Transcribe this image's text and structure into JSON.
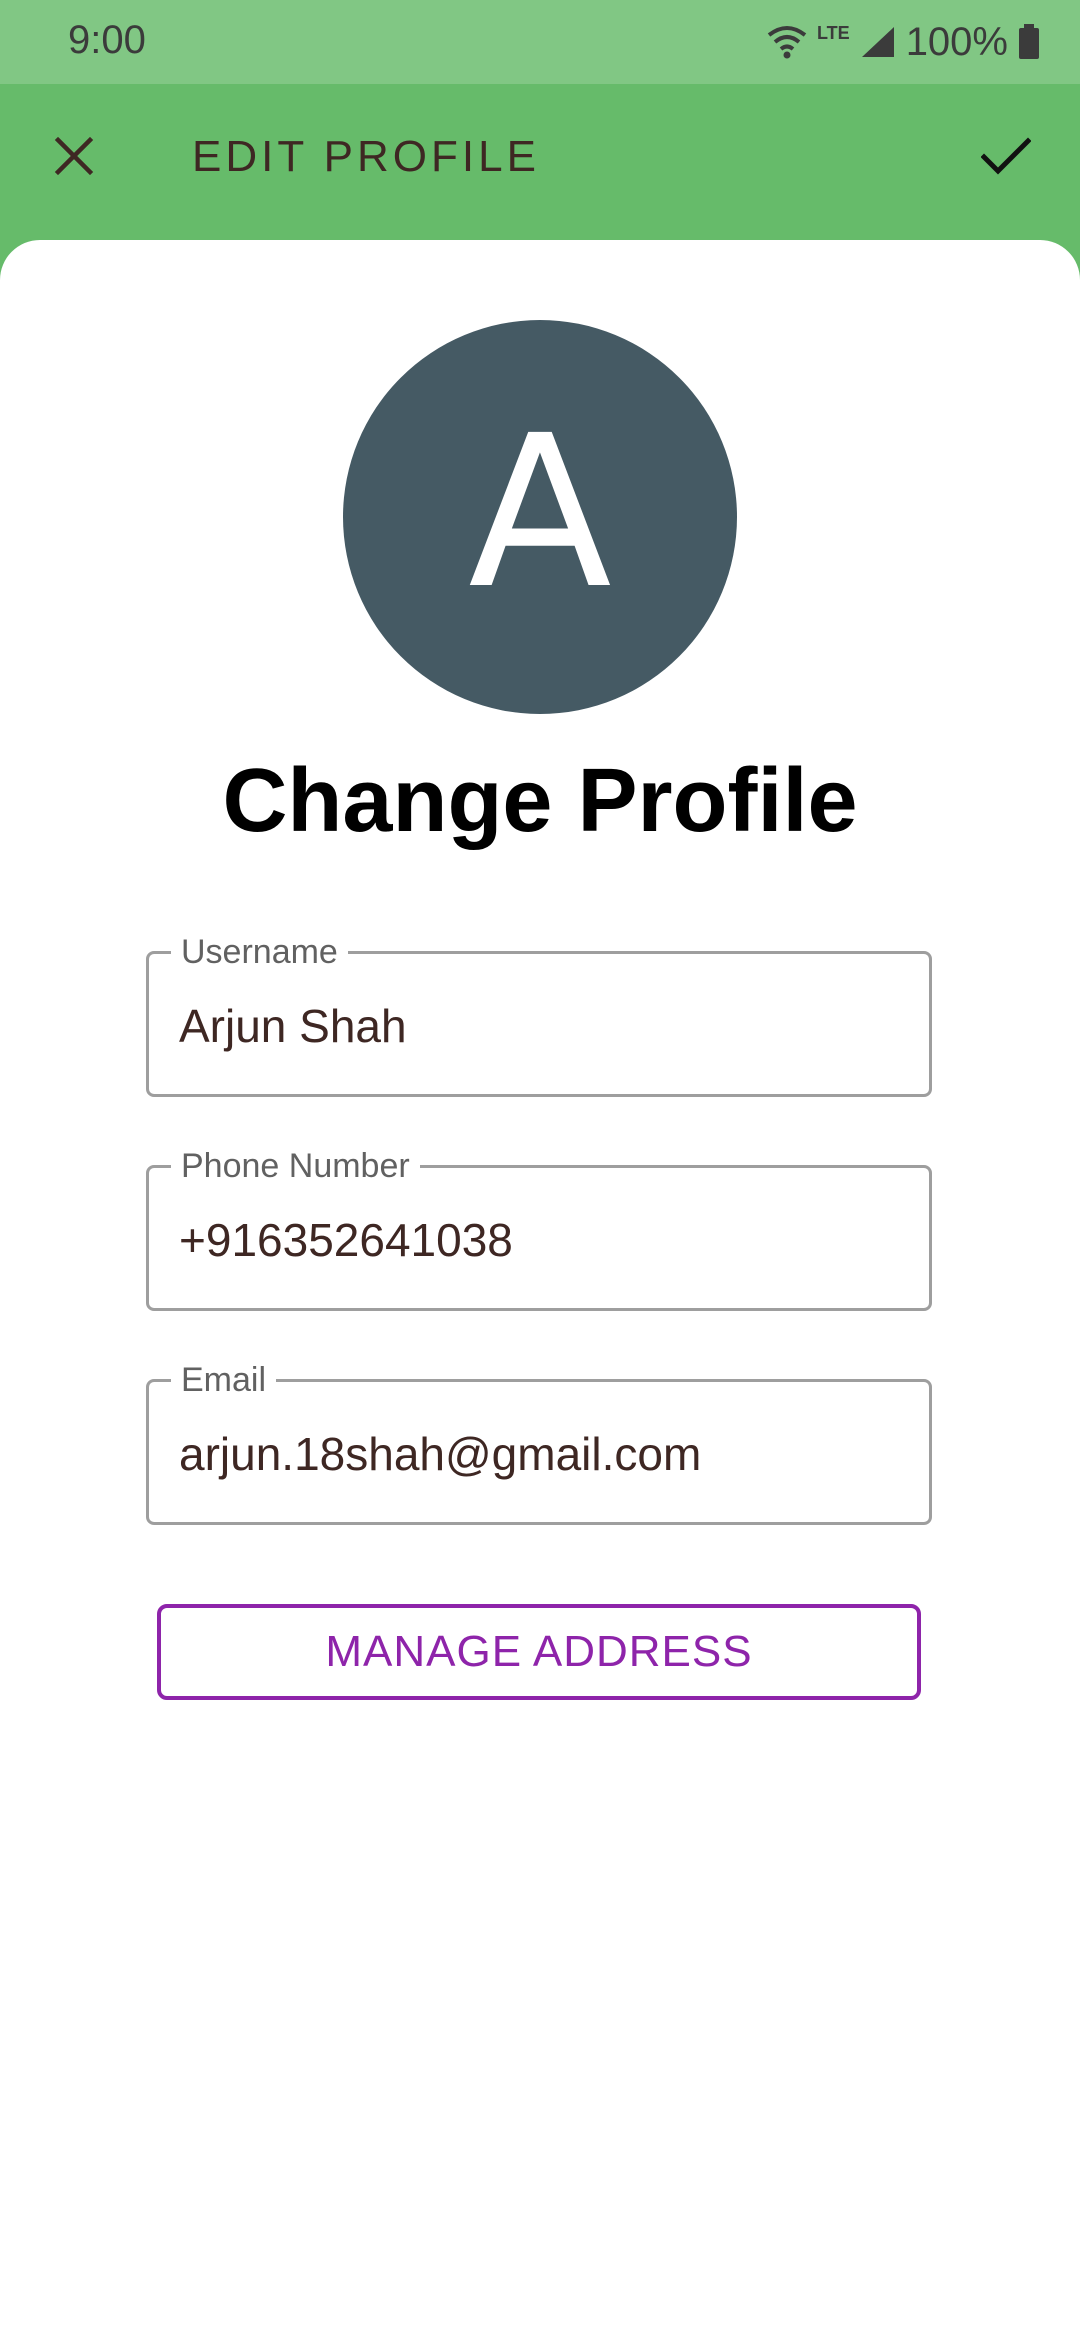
{
  "status_bar": {
    "time": "9:00",
    "network_type": "LTE",
    "battery": "100%"
  },
  "app_bar": {
    "title": "EDIT PROFILE",
    "close_icon": "close-icon",
    "confirm_icon": "check-icon"
  },
  "profile": {
    "avatar_letter": "A",
    "heading": "Change Profile"
  },
  "form": {
    "username": {
      "label": "Username",
      "value": "Arjun Shah"
    },
    "phone": {
      "label": "Phone Number",
      "value": "+916352641038"
    },
    "email": {
      "label": "Email",
      "value": "arjun.18shah@gmail.com"
    }
  },
  "actions": {
    "manage_address": "MANAGE ADDRESS"
  },
  "colors": {
    "status_bar": "#81c784",
    "app_bar": "#66bb6a",
    "avatar": "#455a64",
    "accent": "#8e24aa"
  }
}
